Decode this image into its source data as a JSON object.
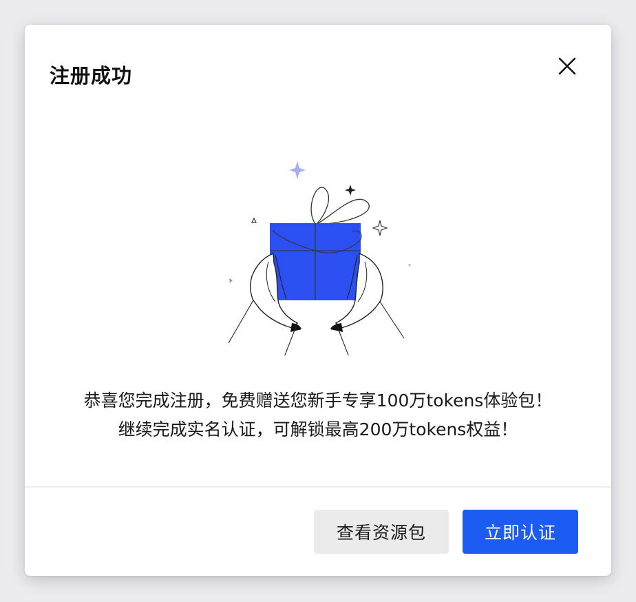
{
  "dialog": {
    "title": "注册成功",
    "message_line1": "恭喜您完成注册，免费赠送您新手专享100万tokens体验包！",
    "message_line2": "继续完成实名认证，可解锁最高200万tokens权益！",
    "secondary_button_label": "查看资源包",
    "primary_button_label": "立即认证",
    "close_icon": "close-icon",
    "illustration_icon": "gift-box-in-hands-icon"
  },
  "colors": {
    "primary": "#1d5cf2",
    "secondary_bg": "#ebebeb",
    "gift_box": "#2b4ff0",
    "sparkle_accent": "#a8aef5"
  }
}
